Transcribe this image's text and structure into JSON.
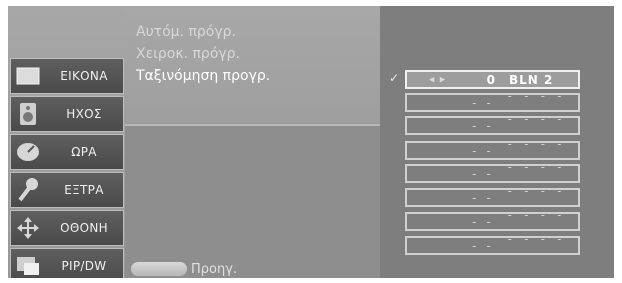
{
  "sidebar": {
    "items": [
      {
        "label": "ΕΙΚΟΝΑ",
        "icon": "picture-icon"
      },
      {
        "label": "ΗΧΟΣ",
        "icon": "speaker-icon"
      },
      {
        "label": "ΩΡΑ",
        "icon": "clock-icon"
      },
      {
        "label": "ΕΞΤΡΑ",
        "icon": "extra-icon"
      },
      {
        "label": "ΟΘΟΝΗ",
        "icon": "move-icon"
      },
      {
        "label": "PIP/DW",
        "icon": "pip-icon"
      }
    ]
  },
  "menu": {
    "items": [
      {
        "label": "Αυτόμ. πρόγρ."
      },
      {
        "label": "Χειροκ. πρόγρ."
      },
      {
        "label": "Ταξινόμηση προγρ."
      }
    ]
  },
  "footer": {
    "label": "Προηγ."
  },
  "programs": {
    "check": "✓",
    "selected_arrows": "◀ ▶",
    "rows": [
      {
        "num": "0",
        "name": "BLN 2"
      },
      {
        "num": "- -",
        "name": "- - - - -"
      },
      {
        "num": "- -",
        "name": "- - - - -"
      },
      {
        "num": "- -",
        "name": "- - - - -"
      },
      {
        "num": "- -",
        "name": "- - - - -"
      },
      {
        "num": "- -",
        "name": "- - - - -"
      },
      {
        "num": "- -",
        "name": "- - - - -"
      },
      {
        "num": "- -",
        "name": "- - - - -"
      }
    ]
  }
}
